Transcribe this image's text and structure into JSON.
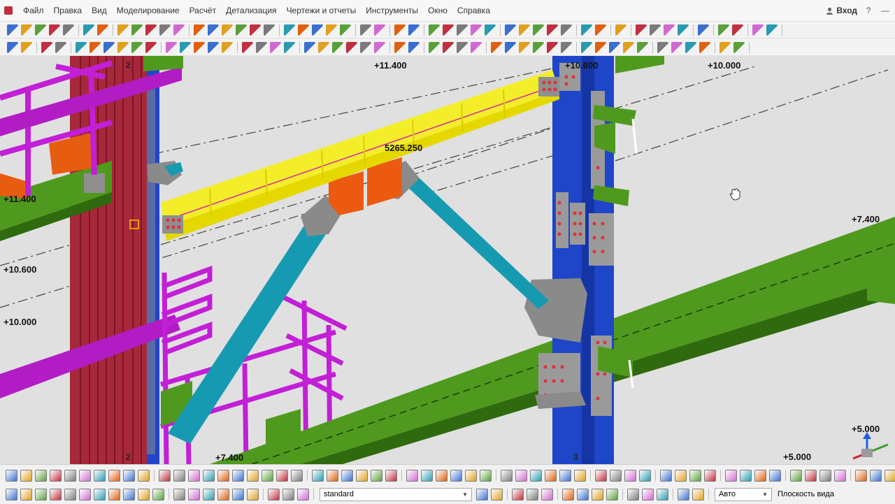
{
  "menu": {
    "items": [
      "Файл",
      "Правка",
      "Вид",
      "Моделирование",
      "Расчёт",
      "Детализация",
      "Чертежи и отчеты",
      "Инструменты",
      "Окно",
      "Справка"
    ],
    "login_label": "Вход",
    "help_glyph": "?",
    "minimize_glyph": "—"
  },
  "icons": {
    "app": "tekla-app-icon",
    "login": "user-icon",
    "cursor": "hand-pan-icon",
    "coord_system": "coordinate-system-icon"
  },
  "colors": {
    "beam_highlight": "#f4ee2a",
    "column": "#1f45c8",
    "brace": "#169ab2",
    "secondary_beam": "#4f9a1e",
    "railing": "#c21fd6",
    "red_column": "#a8283b",
    "plate": "#9a9a9a",
    "gusset": "#ec5a12",
    "viewport_bg": "#e0e0e0"
  },
  "viewport": {
    "levels": [
      "+11.400",
      "+10.600",
      "+10.000",
      "+11.400",
      "+10.600",
      "+10.000",
      "+7.400",
      "+7.400",
      "+5.000",
      "+5.000"
    ],
    "dimension": "5265.250",
    "grid_labels": [
      "2",
      "2",
      "3"
    ]
  },
  "bottombar": {
    "filter_value": "standard",
    "snap_value": "Авто",
    "plane_label": "Плоскость вида"
  }
}
